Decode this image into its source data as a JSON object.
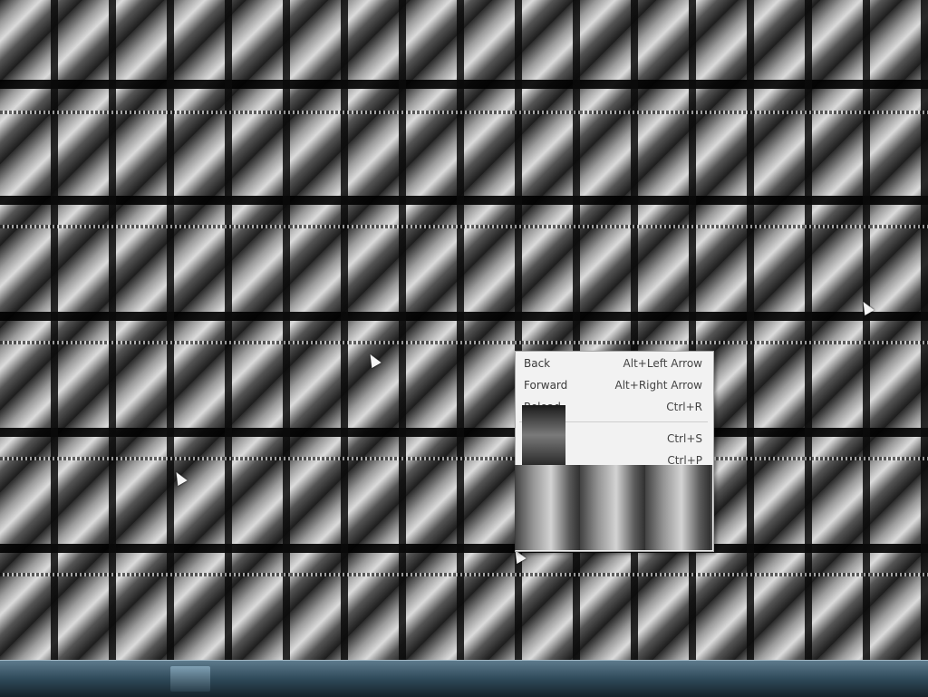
{
  "context_menu": {
    "items": [
      {
        "label": "Back",
        "shortcut": "Alt+Left Arrow"
      },
      {
        "label": "Forward",
        "shortcut": "Alt+Right Arrow"
      },
      {
        "label": "Reload",
        "shortcut": "Ctrl+R"
      },
      {
        "label": "",
        "shortcut": "Ctrl+S"
      },
      {
        "label": "",
        "shortcut": "Ctrl+P"
      }
    ]
  },
  "colors": {
    "menu_background": "#f2f2f2",
    "menu_text": "#3a3a3a",
    "taskbar": "#2f4a5a"
  },
  "icons": [
    "mouse-cursor-icon"
  ]
}
